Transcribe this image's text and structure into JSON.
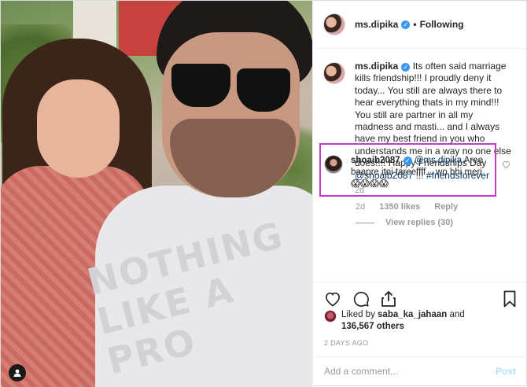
{
  "post": {
    "author": "ms.dipika",
    "follow_state": "Following",
    "separator": "•"
  },
  "photo": {
    "shirt_print": "NOTHING\nLIKE A\nPRO"
  },
  "caption": {
    "username": "ms.dipika",
    "text": "Its often said marriage kills friendship!!! I proudly deny it today... You still are always there to hear everything thats in my mind!!! You still are partner in all my madness and masti... and I always have my best friend in you who understands me in a way no one else does!!!! Happy Friendships Day ",
    "mention": "@shoaib2087",
    "after_mention": " !!!",
    "hashtag": "#friendsforever",
    "time": "2d"
  },
  "reply": {
    "username": "shoaib2087",
    "mention": "@ms.dipika",
    "text": " Aree baapre itni tareeffff... wo bhi meri ",
    "emoji": "😱😱😱😱",
    "time": "2d",
    "likes": "1350 likes",
    "reply_label": "Reply",
    "view_replies": "View replies (30)"
  },
  "likes": {
    "prefix": "Liked by ",
    "user": "saba_ka_jahaan",
    "and": " and",
    "count": "136,567 others"
  },
  "date": "2 DAYS AGO",
  "comment_box": {
    "placeholder": "Add a comment...",
    "post_label": "Post"
  },
  "icons": {
    "like": "heart-icon",
    "comment": "comment-icon",
    "share": "share-icon",
    "save": "bookmark-icon",
    "tag": "user-tag-icon",
    "verified": "verified-badge-icon"
  },
  "colors": {
    "verified": "#3897f0",
    "highlight_border": "#c43bc4",
    "link": "#003569",
    "post_disabled": "#b2dffc"
  }
}
